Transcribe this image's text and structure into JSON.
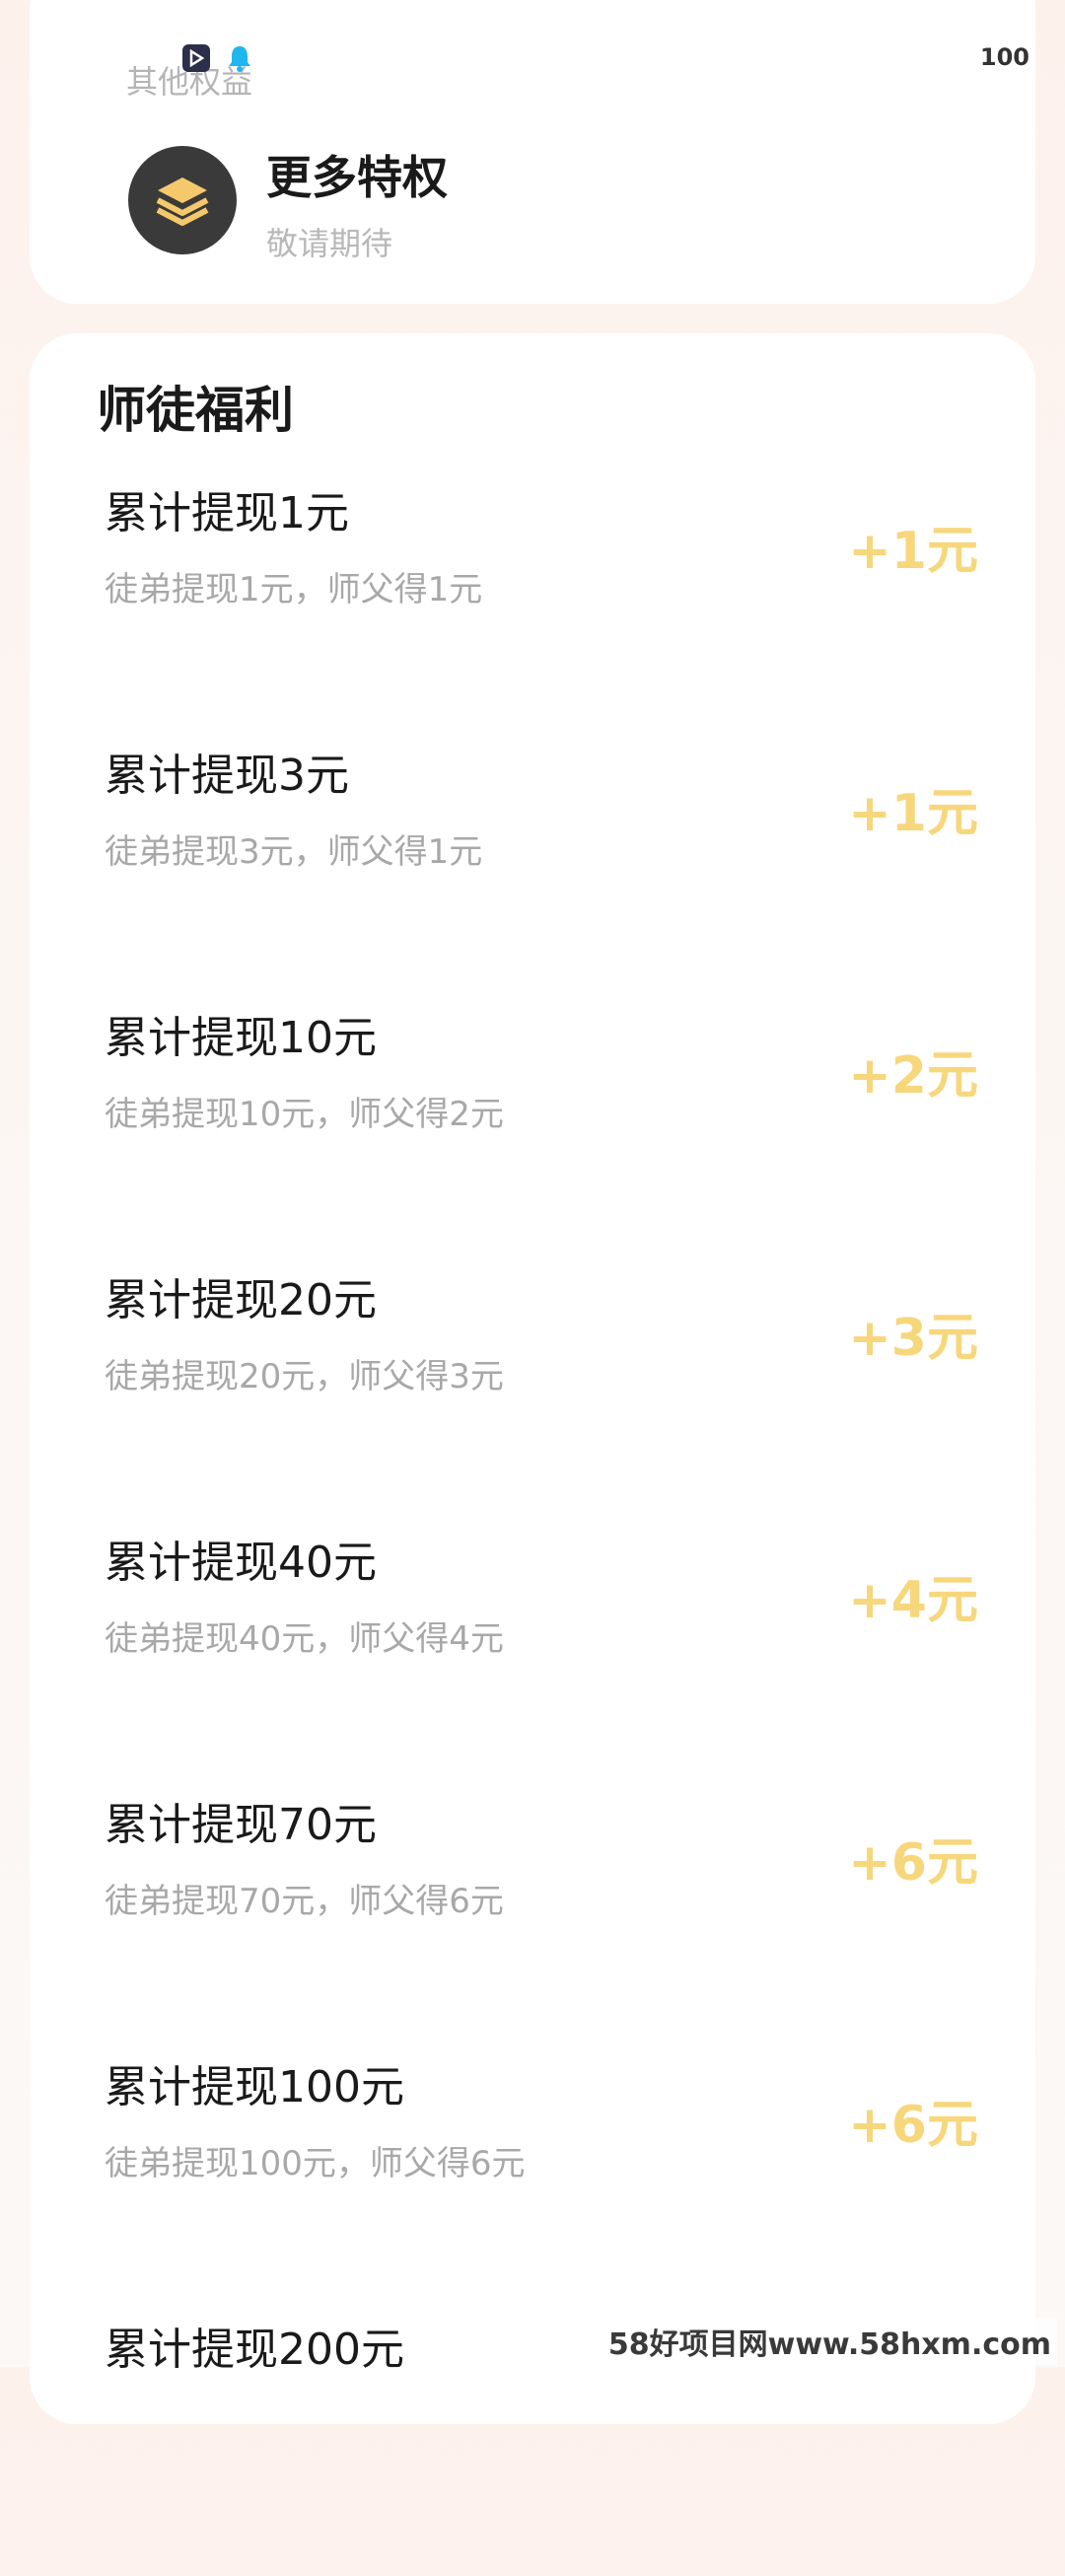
{
  "status": {
    "right_value": "100",
    "icons": [
      "video-app-icon",
      "qq-bell-icon"
    ]
  },
  "other_privileges": {
    "section_title": "其他权益",
    "item": {
      "icon": "layers-stack-icon",
      "title": "更多特权",
      "subtitle": "敬请期待"
    }
  },
  "mentor_benefits": {
    "title": "师徒福利",
    "items": [
      {
        "title": "累计提现1元",
        "desc": "徒弟提现1元，师父得1元",
        "reward": "+1元"
      },
      {
        "title": "累计提现3元",
        "desc": "徒弟提现3元，师父得1元",
        "reward": "+1元"
      },
      {
        "title": "累计提现10元",
        "desc": "徒弟提现10元，师父得2元",
        "reward": "+2元"
      },
      {
        "title": "累计提现20元",
        "desc": "徒弟提现20元，师父得3元",
        "reward": "+3元"
      },
      {
        "title": "累计提现40元",
        "desc": "徒弟提现40元，师父得4元",
        "reward": "+4元"
      },
      {
        "title": "累计提现70元",
        "desc": "徒弟提现70元，师父得6元",
        "reward": "+6元"
      },
      {
        "title": "累计提现100元",
        "desc": "徒弟提现100元，师父得6元",
        "reward": "+6元"
      },
      {
        "title": "累计提现200元",
        "desc": "",
        "reward": ""
      }
    ]
  },
  "watermark": "58好项目网www.58hxm.com",
  "colors": {
    "reward": "#f7d77c",
    "subtle_text": "#a8a8a8",
    "card": "#ffffff",
    "background": "#fdf1ec"
  }
}
